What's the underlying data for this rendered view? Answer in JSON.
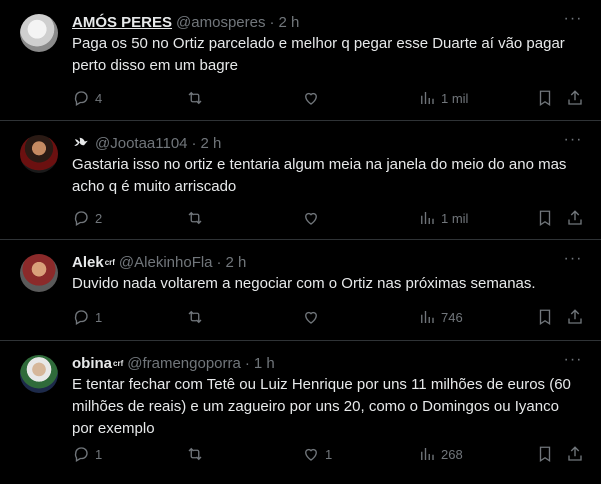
{
  "tweets": [
    {
      "name": "AMÓS PERES",
      "handle": "@amosperes",
      "time": "2 h",
      "badge": "",
      "text": "Paga os 50 no Ortiz parcelado e melhor q pegar esse Duarte aí vão pagar perto disso em um bagre",
      "replies": "4",
      "retweets": "",
      "likes": "",
      "views": "1 mil"
    },
    {
      "name": "",
      "handle": "@Jootaa1104",
      "time": "2 h",
      "badge": "",
      "text": "Gastaria isso no ortiz e tentaria algum meia na janela do meio do ano mas acho q é muito arriscado",
      "replies": "2",
      "retweets": "",
      "likes": "",
      "views": "1 mil"
    },
    {
      "name": "Alek",
      "handle": "@AlekinhoFla",
      "time": "2 h",
      "badge": "crf",
      "text": "Duvido nada voltarem a negociar com o Ortiz nas próximas semanas.",
      "replies": "1",
      "retweets": "",
      "likes": "",
      "views": "746"
    },
    {
      "name": "obina",
      "handle": "@framengoporra",
      "time": "1 h",
      "badge": "crf",
      "text": "E tentar fechar com Tetê ou Luiz Henrique por uns 11 milhões de euros (60 milhões de reais) e um zagueiro por uns 20, como o Domingos ou Iyanco por exemplo",
      "replies": "1",
      "retweets": "",
      "likes": "1",
      "views": "268"
    }
  ],
  "separator": "·",
  "colors": {
    "background": "#000000",
    "text": "#e7e9ea",
    "muted": "#71767b",
    "border": "#2f3336"
  },
  "icons": [
    "more-icon",
    "reply-icon",
    "retweet-icon",
    "like-icon",
    "views-icon",
    "bookmark-icon",
    "share-icon",
    "bird-icon"
  ]
}
